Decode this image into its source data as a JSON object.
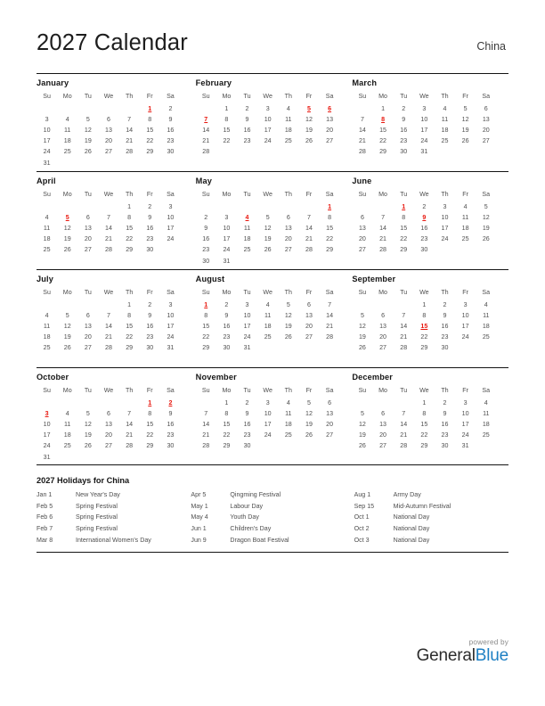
{
  "header": {
    "title": "2027 Calendar",
    "country": "China"
  },
  "weekday_headers": [
    "Su",
    "Mo",
    "Tu",
    "We",
    "Th",
    "Fr",
    "Sa"
  ],
  "months": [
    {
      "name": "January",
      "lead_blanks": 5,
      "days": 31,
      "holidays": [
        1
      ]
    },
    {
      "name": "February",
      "lead_blanks": 1,
      "days": 28,
      "holidays": [
        5,
        6,
        7
      ]
    },
    {
      "name": "March",
      "lead_blanks": 1,
      "days": 31,
      "holidays": [
        8
      ]
    },
    {
      "name": "April",
      "lead_blanks": 4,
      "days": 30,
      "holidays": [
        5
      ]
    },
    {
      "name": "May",
      "lead_blanks": 6,
      "days": 31,
      "holidays": [
        1,
        4
      ]
    },
    {
      "name": "June",
      "lead_blanks": 2,
      "days": 30,
      "holidays": [
        1,
        9
      ]
    },
    {
      "name": "July",
      "lead_blanks": 4,
      "days": 31,
      "holidays": []
    },
    {
      "name": "August",
      "lead_blanks": 0,
      "days": 31,
      "holidays": [
        1
      ]
    },
    {
      "name": "September",
      "lead_blanks": 3,
      "days": 30,
      "holidays": [
        15
      ]
    },
    {
      "name": "October",
      "lead_blanks": 5,
      "days": 31,
      "holidays": [
        1,
        2,
        3
      ]
    },
    {
      "name": "November",
      "lead_blanks": 1,
      "days": 30,
      "holidays": []
    },
    {
      "name": "December",
      "lead_blanks": 3,
      "days": 31,
      "holidays": []
    }
  ],
  "holidays_section": {
    "title": "2027 Holidays for China",
    "columns": [
      [
        {
          "date": "Jan 1",
          "name": "New Year's Day"
        },
        {
          "date": "Feb 5",
          "name": "Spring Festival"
        },
        {
          "date": "Feb 6",
          "name": "Spring Festival"
        },
        {
          "date": "Feb 7",
          "name": "Spring Festival"
        },
        {
          "date": "Mar 8",
          "name": "International Women's Day"
        }
      ],
      [
        {
          "date": "Apr 5",
          "name": "Qingming Festival"
        },
        {
          "date": "May 1",
          "name": "Labour Day"
        },
        {
          "date": "May 4",
          "name": "Youth Day"
        },
        {
          "date": "Jun 1",
          "name": "Children's Day"
        },
        {
          "date": "Jun 9",
          "name": "Dragon Boat Festival"
        }
      ],
      [
        {
          "date": "Aug 1",
          "name": "Army Day"
        },
        {
          "date": "Sep 15",
          "name": "Mid-Autumn Festival"
        },
        {
          "date": "Oct 1",
          "name": "National Day"
        },
        {
          "date": "Oct 2",
          "name": "National Day"
        },
        {
          "date": "Oct 3",
          "name": "National Day"
        }
      ]
    ]
  },
  "footer": {
    "powered_by": "powered by",
    "brand_first": "General",
    "brand_second": "Blue",
    "brand_color": "#1d7fc3"
  },
  "colors": {
    "holiday": "#e8150c",
    "text": "#4e4e4e",
    "heading": "#161616",
    "rule": "#141414"
  }
}
